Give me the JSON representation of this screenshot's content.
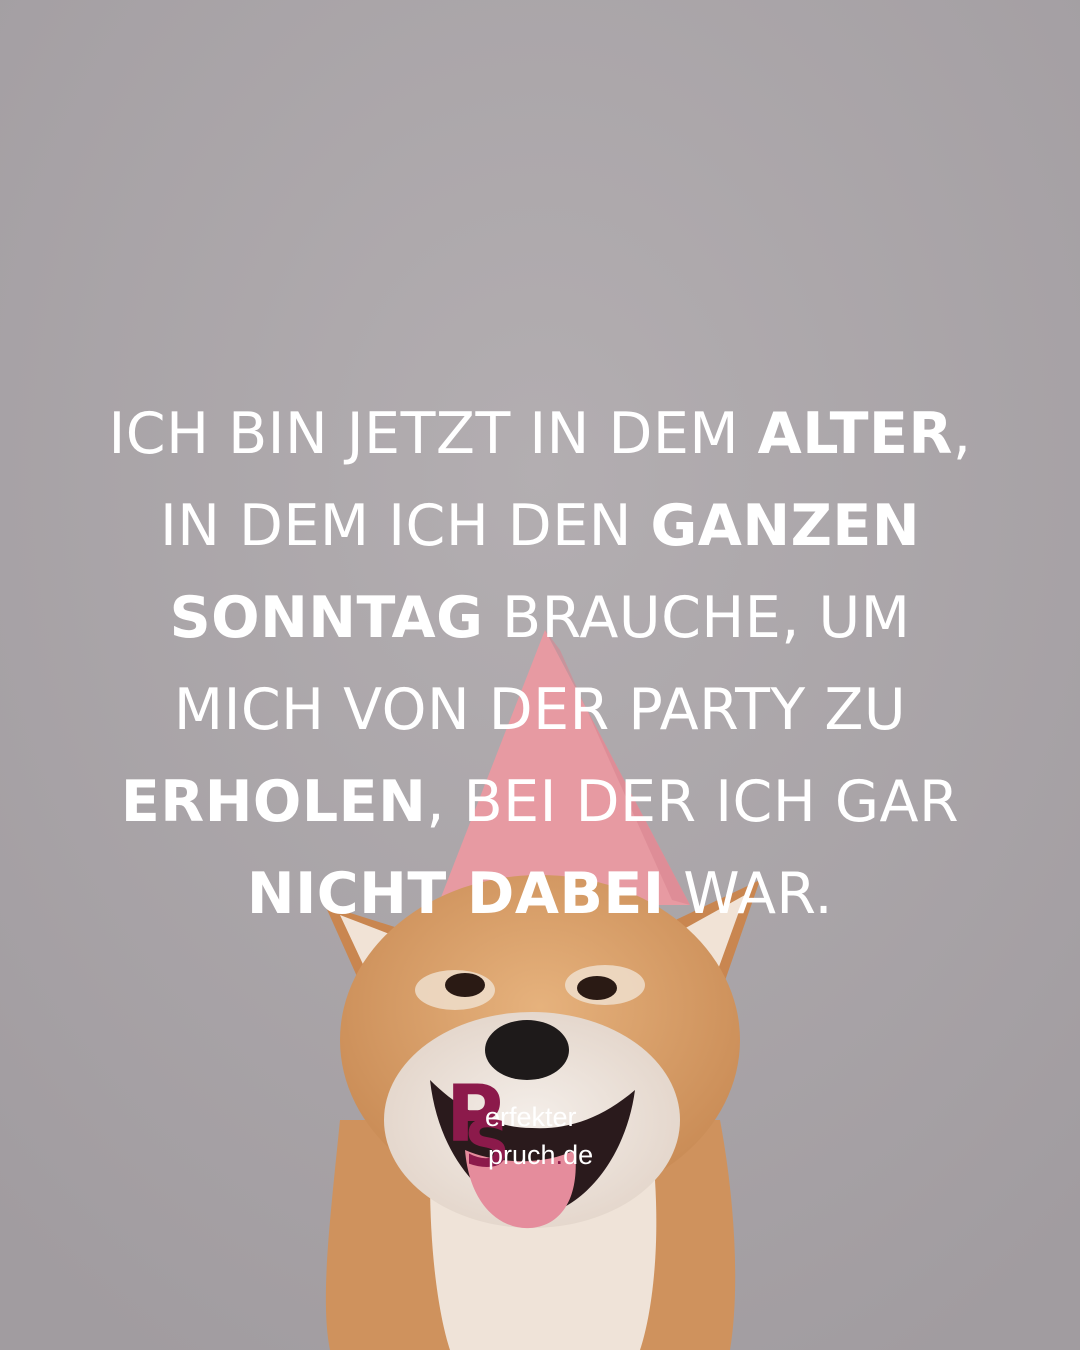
{
  "quote": {
    "lines": [
      [
        {
          "t": "Ich bin jetzt in dem ",
          "b": false
        },
        {
          "t": "Alter",
          "b": true
        },
        {
          "t": ",",
          "b": false
        }
      ],
      [
        {
          "t": "in dem ich den ",
          "b": false
        },
        {
          "t": "ganzen",
          "b": true
        }
      ],
      [
        {
          "t": "Sonntag",
          "b": true
        },
        {
          "t": " brauche, um",
          "b": false
        }
      ],
      [
        {
          "t": "mich von der Party zu",
          "b": false
        }
      ],
      [
        {
          "t": "erholen",
          "b": true
        },
        {
          "t": ", bei der ich gar",
          "b": false
        }
      ],
      [
        {
          "t": "nicht dabei",
          "b": true
        },
        {
          "t": " war.",
          "b": false
        }
      ]
    ]
  },
  "logo": {
    "mark_p": "P",
    "mark_s": "S",
    "line1": "erfekter",
    "line2_a": "pruch",
    "line2_dot": ".",
    "line2_b": "de"
  },
  "colors": {
    "background": "#a9a4a8",
    "text": "#ffffff",
    "brand": "#8c1a4b",
    "party_hat": "#e79aa2",
    "dog_fur": "#d99a61"
  }
}
